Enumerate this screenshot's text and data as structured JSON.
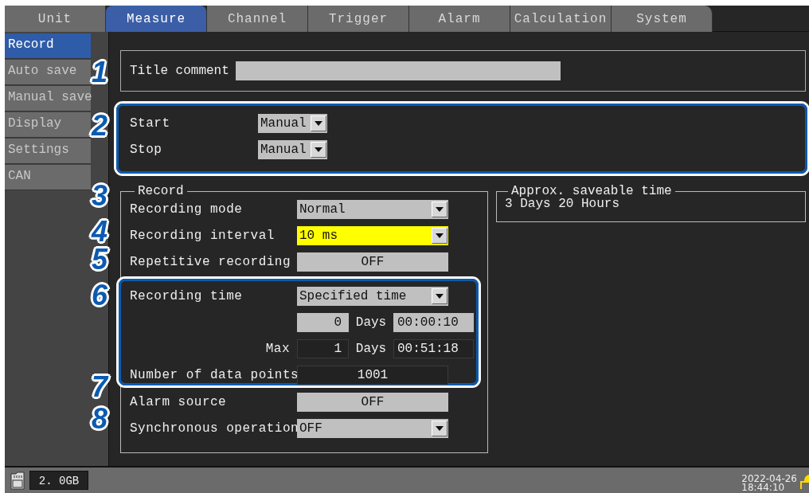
{
  "tabs": [
    {
      "label": "Unit",
      "selected": false
    },
    {
      "label": "Measure",
      "selected": true
    },
    {
      "label": "Channel",
      "selected": false
    },
    {
      "label": "Trigger",
      "selected": false
    },
    {
      "label": "Alarm",
      "selected": false
    },
    {
      "label": "Calculation",
      "selected": false
    },
    {
      "label": "System",
      "selected": false
    }
  ],
  "sidebar": {
    "items": [
      {
        "label": "Record",
        "selected": true
      },
      {
        "label": "Auto save",
        "selected": false
      },
      {
        "label": "Manual save",
        "selected": false
      },
      {
        "label": "Display",
        "selected": false
      },
      {
        "label": "Settings",
        "selected": false
      },
      {
        "label": "CAN",
        "selected": false
      }
    ]
  },
  "callouts": [
    "1",
    "2",
    "3",
    "4",
    "5",
    "6",
    "7",
    "8"
  ],
  "title_comment": {
    "label": "Title comment"
  },
  "start_stop": {
    "highlighted": true,
    "rows": [
      {
        "label": "Start",
        "value": "Manual"
      },
      {
        "label": "Stop",
        "value": "Manual"
      }
    ]
  },
  "record": {
    "title": "Record",
    "rows": [
      {
        "kind": "dropdown",
        "label": "Recording mode",
        "value": "Normal",
        "highlighted": false
      },
      {
        "kind": "dropdown",
        "label": "Recording interval",
        "value": "10 ms",
        "highlighted": true
      },
      {
        "kind": "toggle",
        "label": "Repetitive recording",
        "value": "OFF"
      }
    ],
    "time_group": {
      "highlighted": true,
      "rows": [
        {
          "kind": "dropdown",
          "label": "Recording time",
          "value": "Specified time",
          "highlighted": false
        },
        {
          "kind": "duration",
          "days": "0",
          "unit": "Days",
          "time": "00:00:10",
          "editable": true
        },
        {
          "kind": "duration",
          "label": "Max",
          "days": "1",
          "unit": "Days",
          "time": "00:51:18",
          "editable": false
        },
        {
          "kind": "readout",
          "label": "Number of data points",
          "value": "1001"
        }
      ]
    },
    "rows_after": [
      {
        "kind": "toggle",
        "label": "Alarm source",
        "value": "OFF"
      },
      {
        "kind": "dropdown",
        "label": "Synchronous operation",
        "value": "OFF",
        "highlighted": false
      }
    ]
  },
  "saveable_time": {
    "title": "Approx. saveable time",
    "value": "3 Days 20 Hours"
  },
  "status_bar": {
    "storage": "2. 0GB",
    "date": "2022-04-26",
    "time": "18:44:10"
  }
}
